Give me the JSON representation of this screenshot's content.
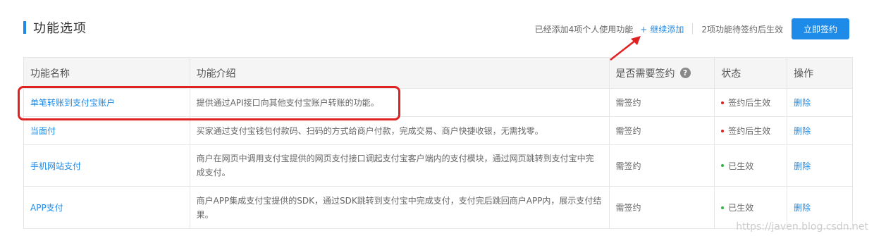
{
  "header": {
    "title": "功能选项",
    "added_text": "已经添加4项个人使用功能",
    "add_more_icon": "+",
    "add_more_label": "继续添加",
    "pending_text": "2项功能待签约后生效",
    "sign_button_label": "立即签约"
  },
  "table": {
    "columns": [
      "功能名称",
      "功能介绍",
      "是否需要签约",
      "状态",
      "操作"
    ],
    "help_icon": "?",
    "rows": [
      {
        "name": "单笔转账到支付宝账户",
        "desc": "提供通过API接口向其他支付宝账户转账的功能。",
        "sign": "需签约",
        "status": "签约后生效",
        "status_color": "#e02121",
        "action": "删除"
      },
      {
        "name": "当面付",
        "desc": "买家通过支付宝钱包付款码、扫码的方式给商户付款，完成交易、商户快捷收银，无需找零。",
        "sign": "需签约",
        "status": "签约后生效",
        "status_color": "#e02121",
        "action": "删除"
      },
      {
        "name": "手机网站支付",
        "desc": "商户在网页中调用支付宝提供的网页支付接口调起支付宝客户端内的支付模块，通过网页跳转到支付宝中完成支付。",
        "sign": "需签约",
        "status": "已生效",
        "status_color": "#2fb344",
        "action": "删除"
      },
      {
        "name": "APP支付",
        "desc": "商户APP集成支付宝提供的SDK，通过SDK跳转到支付宝中完成支付，支付完后跳回商户APP内，展示支付结果。",
        "sign": "需签约",
        "status": "已生效",
        "status_color": "#2fb344",
        "action": "删除"
      }
    ]
  },
  "watermark": "https://javen.blog.csdn.net",
  "colors": {
    "accent": "#1E8BE8",
    "annotation": "#e02121"
  }
}
